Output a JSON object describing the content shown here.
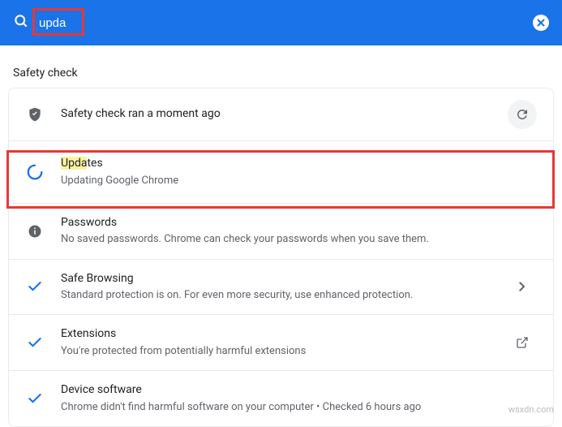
{
  "search": {
    "query": "upda"
  },
  "section": {
    "title": "Safety check"
  },
  "rows": {
    "safety": {
      "title": "Safety check ran a moment ago"
    },
    "updates": {
      "title_pre": "Upda",
      "title_post": "tes",
      "sub": "Updating Google Chrome"
    },
    "passwords": {
      "title": "Passwords",
      "sub": "No saved passwords. Chrome can check your passwords when you save them."
    },
    "safebrowsing": {
      "title": "Safe Browsing",
      "sub": "Standard protection is on. For even more security, use enhanced protection."
    },
    "extensions": {
      "title": "Extensions",
      "sub": "You're protected from potentially harmful extensions"
    },
    "device": {
      "title": "Device software",
      "sub": "Chrome didn't find harmful software on your computer • Checked 6 hours ago"
    }
  },
  "watermark": "wsxdn.com"
}
